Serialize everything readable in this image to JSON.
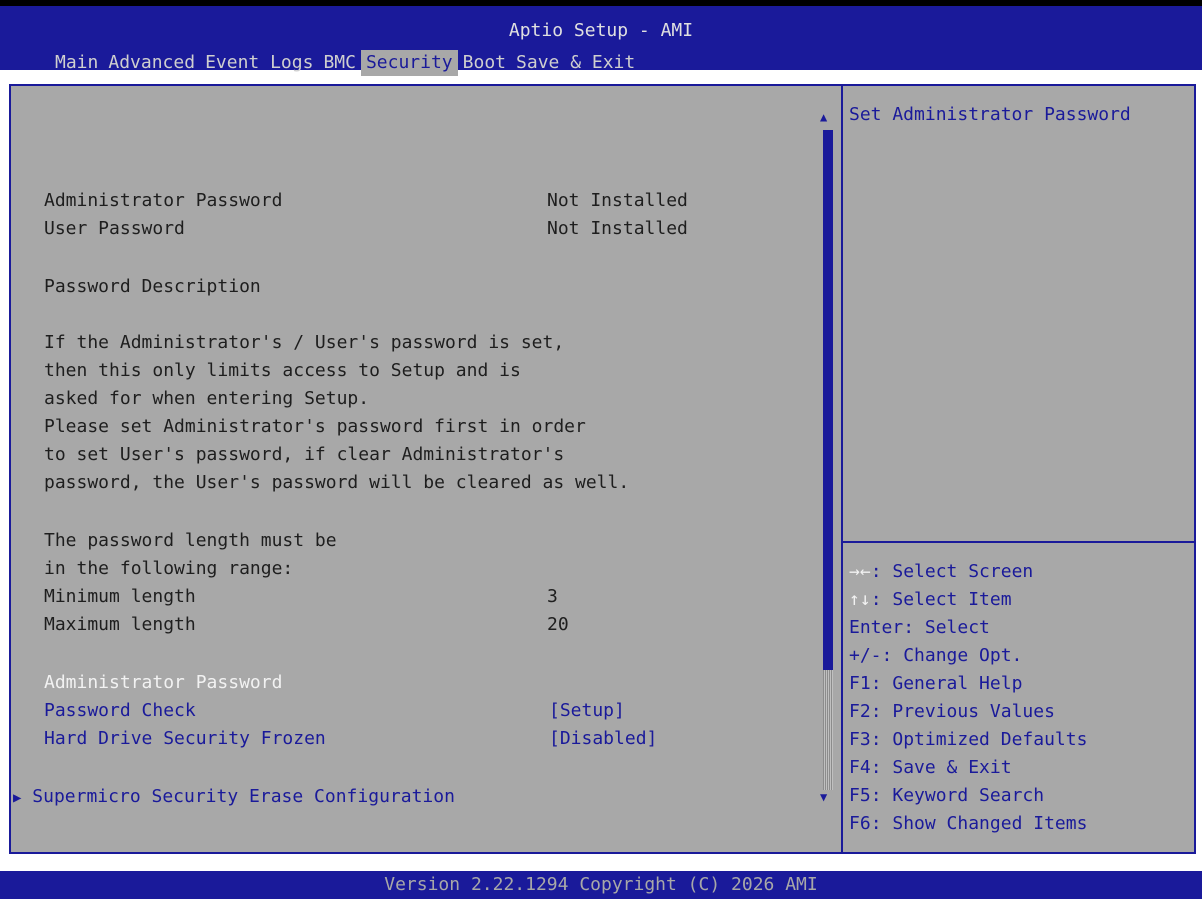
{
  "header": {
    "title": "Aptio Setup - AMI",
    "tabs": [
      {
        "label": "Main"
      },
      {
        "label": "Advanced"
      },
      {
        "label": "Event Logs"
      },
      {
        "label": "BMC"
      },
      {
        "label": "Security"
      },
      {
        "label": "Boot"
      },
      {
        "label": "Save & Exit"
      }
    ],
    "active_tab": "Security"
  },
  "content": {
    "admin_password_label": "Administrator Password",
    "admin_password_status": "Not Installed",
    "user_password_label": "User Password",
    "user_password_status": "Not Installed",
    "password_description_title": "Password Description",
    "description_lines": [
      "If the Administrator's / User's password is set,",
      "then this only limits access to Setup and is",
      "asked for when entering Setup.",
      "Please set Administrator's password first in order",
      "to set User's password, if clear Administrator's",
      "password, the User's password will be cleared as well."
    ],
    "length_lines": [
      "The password length must be",
      "in the following range:"
    ],
    "min_length_label": "Minimum length",
    "min_length_value": "3",
    "max_length_label": "Maximum length",
    "max_length_value": "20",
    "admin_password_item": "Administrator Password",
    "password_check_label": "Password Check",
    "password_check_value": "[Setup]",
    "hd_security_frozen_label": "Hard Drive Security Frozen",
    "hd_security_frozen_value": "[Disabled]",
    "submenu_label": "Supermicro Security Erase Configuration",
    "submenu_icon": "triangle-right-icon"
  },
  "help": {
    "text": "Set Administrator Password",
    "keys": [
      {
        "key": "→←",
        "desc": ": Select Screen"
      },
      {
        "key": "↑↓",
        "desc": ": Select Item"
      },
      {
        "key": "Enter",
        "desc": ": Select"
      },
      {
        "key": "+/-",
        "desc": ": Change Opt."
      },
      {
        "key": "F1",
        "desc": ": General Help"
      },
      {
        "key": "F2",
        "desc": ": Previous Values"
      },
      {
        "key": "F3",
        "desc": ": Optimized Defaults"
      },
      {
        "key": "F4",
        "desc": ": Save & Exit"
      },
      {
        "key": "F5",
        "desc": ": Keyword Search"
      },
      {
        "key": "F6",
        "desc": ": Show Changed Items"
      }
    ]
  },
  "footer": {
    "version": "Version 2.22.1294 Copyright (C) 2026 AMI"
  },
  "colors": {
    "bar_blue": "#1a1a9a",
    "panel_gray": "#a8a8a8",
    "highlight_white": "#f2f2f2"
  }
}
